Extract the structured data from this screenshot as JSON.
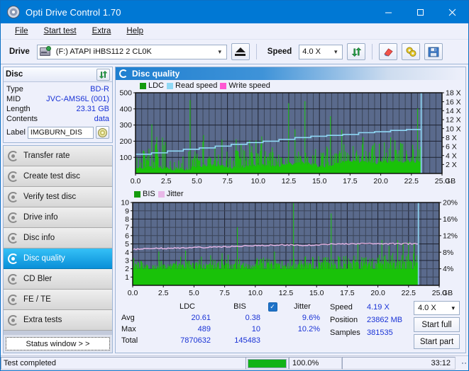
{
  "window": {
    "title": "Opti Drive Control 1.70",
    "icon": "disc-icon",
    "minimize": "minimize-icon",
    "maximize": "maximize-icon",
    "close": "close-icon"
  },
  "menu": {
    "items": [
      {
        "label": "File",
        "accel": "F"
      },
      {
        "label": "Start test",
        "accel": "S"
      },
      {
        "label": "Extra",
        "accel": "x"
      },
      {
        "label": "Help",
        "accel": "H"
      }
    ]
  },
  "toolbar": {
    "drive_label": "Drive",
    "drive_value": "(F:)  ATAPI iHBS112  2 CL0K",
    "eject_icon": "eject-icon",
    "speed_label": "Speed",
    "speed_value": "4.0 X",
    "refresh_icon": "refresh-icon",
    "eraser_icon": "eraser-icon",
    "settings_icon": "settings-icon",
    "save_icon": "save-icon"
  },
  "disc_panel": {
    "title": "Disc",
    "refresh_icon": "refresh-icon",
    "rows": [
      {
        "key": "Type",
        "value": "BD-R"
      },
      {
        "key": "MID",
        "value": "JVC-AMS6L (001)"
      },
      {
        "key": "Length",
        "value": "23.31 GB"
      },
      {
        "key": "Contents",
        "value": "data"
      }
    ],
    "label_key": "Label",
    "label_value": "IMGBURN_DIS",
    "label_icon": "cd-icon"
  },
  "nav": {
    "items": [
      {
        "label": "Transfer rate",
        "icon": "disc-transfer-icon",
        "selected": false
      },
      {
        "label": "Create test disc",
        "icon": "disc-create-icon",
        "selected": false
      },
      {
        "label": "Verify test disc",
        "icon": "disc-verify-icon",
        "selected": false
      },
      {
        "label": "Drive info",
        "icon": "disc-drive-icon",
        "selected": false
      },
      {
        "label": "Disc info",
        "icon": "disc-info-icon",
        "selected": false
      },
      {
        "label": "Disc quality",
        "icon": "disc-quality-icon",
        "selected": true
      },
      {
        "label": "CD Bler",
        "icon": "disc-bler-icon",
        "selected": false
      },
      {
        "label": "FE / TE",
        "icon": "disc-fete-icon",
        "selected": false
      },
      {
        "label": "Extra tests",
        "icon": "disc-extra-icon",
        "selected": false
      }
    ],
    "status_button": "Status window > >"
  },
  "panel_header": {
    "title": "Disc quality",
    "icon": "disc-quality-icon"
  },
  "stats": {
    "col_ldc": "LDC",
    "col_bis": "BIS",
    "jitter_label": "Jitter",
    "jitter_checked": true,
    "rows": [
      {
        "key": "Avg",
        "ldc": "20.61",
        "bis": "0.38",
        "jitter": "9.6%"
      },
      {
        "key": "Max",
        "ldc": "489",
        "bis": "10",
        "jitter": "10.2%"
      },
      {
        "key": "Total",
        "ldc": "7870632",
        "bis": "145483",
        "jitter": ""
      }
    ],
    "speed_key": "Speed",
    "speed_value": "4.19 X",
    "position_key": "Position",
    "position_value": "23862 MB",
    "samples_key": "Samples",
    "samples_value": "381535",
    "speed_select": "4.0 X",
    "start_full": "Start full",
    "start_part": "Start part"
  },
  "statusbar": {
    "message": "Test completed",
    "percent_label": "100.0%",
    "progress": 100,
    "time": "33:12",
    "progress_color": "#12b317"
  },
  "colors": {
    "accent": "#0078d4",
    "plot_bg": "#5a6a8c",
    "ldc_green": "#19c209",
    "bis_green": "#19c209",
    "read_speed": "#8fd8f5",
    "write_speed": "#ff57d2",
    "jitter_pink": "#e8b8e8",
    "value_blue": "#1a33d6"
  },
  "chart_data": [
    {
      "type": "area",
      "id": "ldc-chart",
      "title": "",
      "xlabel": "GB",
      "ylabel": "LDC",
      "xlim": [
        0,
        25.0
      ],
      "ylim": [
        0,
        500
      ],
      "y2lim": [
        0,
        18
      ],
      "y2label": "X",
      "xticks": [
        "0.0",
        "2.5",
        "5.0",
        "7.5",
        "10.0",
        "12.5",
        "15.0",
        "17.5",
        "20.0",
        "22.5",
        "25.0"
      ],
      "yticks": [
        100,
        200,
        300,
        400,
        500
      ],
      "y2ticks": [
        "2 X",
        "4 X",
        "6 X",
        "8 X",
        "10 X",
        "12 X",
        "14 X",
        "16 X",
        "18 X"
      ],
      "x_unit": "GB",
      "grid": true,
      "legend": [
        {
          "name": "LDC",
          "color": "#19c209"
        },
        {
          "name": "Read speed",
          "color": "#8fd8f5"
        },
        {
          "name": "Write speed",
          "color": "#ff57d2"
        }
      ],
      "data_end_x": 23.3,
      "series": [
        {
          "name": "LDC",
          "color": "#19c209",
          "kind": "spike-area",
          "baseline": [
            28,
            30,
            30,
            32,
            30,
            31,
            33,
            30,
            32,
            31,
            30,
            33,
            31,
            30,
            32,
            34,
            31,
            30,
            33,
            31,
            30,
            32,
            31,
            33,
            30,
            32,
            31,
            30,
            33,
            31,
            32,
            30,
            33,
            31,
            30,
            32,
            34,
            31,
            33,
            30,
            32,
            31,
            33,
            30,
            32,
            31,
            34,
            30,
            33,
            31,
            32,
            30,
            33,
            31,
            35,
            32,
            30,
            33,
            31,
            34,
            32,
            30,
            33,
            36,
            31,
            34,
            32,
            30,
            33,
            35,
            31,
            34,
            32,
            36,
            33,
            31,
            35,
            32,
            34,
            37,
            31,
            33,
            36,
            32,
            35,
            31,
            34,
            38,
            32,
            36,
            33,
            31,
            37,
            34,
            32,
            38,
            35,
            33,
            40,
            36,
            34,
            32,
            39,
            36,
            42,
            34,
            37,
            33,
            40,
            36,
            38,
            34,
            41,
            37,
            35,
            43,
            38,
            36,
            40,
            34,
            42,
            38,
            45,
            36,
            40,
            37,
            43,
            39,
            41,
            35,
            44,
            38,
            42,
            46,
            39,
            37,
            43,
            40,
            48,
            41,
            38,
            45,
            42,
            39,
            47,
            43,
            40,
            50,
            44,
            41,
            46,
            43,
            52,
            45,
            42,
            48,
            44,
            51,
            46,
            43,
            49,
            45,
            55,
            47,
            44,
            50,
            46,
            53,
            48,
            45,
            52,
            49,
            46,
            56,
            50,
            47,
            54,
            51,
            48,
            58,
            52,
            49,
            55,
            53,
            50,
            60,
            54,
            51,
            57,
            55,
            52,
            62,
            56,
            53,
            59,
            57,
            54,
            64,
            58,
            55,
            61,
            59,
            56,
            66,
            60,
            57,
            63,
            61,
            58,
            68,
            62,
            59,
            65,
            63,
            60,
            70,
            64,
            61,
            67,
            65,
            62,
            72,
            66,
            63,
            69,
            67,
            64,
            74,
            68,
            65,
            71,
            69,
            66,
            76,
            70,
            67,
            73,
            71,
            68,
            78,
            72,
            69,
            75,
            73,
            70,
            80,
            74,
            71,
            77,
            75,
            72,
            82,
            76,
            73,
            79,
            77,
            74,
            84,
            78,
            75,
            81,
            79,
            76,
            86,
            80,
            77,
            83,
            81,
            78,
            88,
            82,
            79,
            85,
            83,
            80,
            90,
            84,
            81,
            87,
            85,
            82,
            92,
            86,
            83,
            89,
            87,
            84,
            94,
            88,
            85,
            91,
            89,
            86,
            96,
            90,
            87,
            93,
            91,
            88,
            98,
            92,
            89,
            95
          ]
        }
      ],
      "read_speed_steps": [
        {
          "x": 0.0,
          "v": 4.3
        },
        {
          "x": 1.3,
          "v": 4.6
        },
        {
          "x": 2.6,
          "v": 5.0
        },
        {
          "x": 3.9,
          "v": 5.4
        },
        {
          "x": 5.2,
          "v": 5.7
        },
        {
          "x": 6.5,
          "v": 6.1
        },
        {
          "x": 7.8,
          "v": 6.5
        },
        {
          "x": 9.1,
          "v": 6.9
        },
        {
          "x": 10.4,
          "v": 7.2
        },
        {
          "x": 11.7,
          "v": 7.6
        },
        {
          "x": 13.0,
          "v": 8.0
        },
        {
          "x": 14.3,
          "v": 8.3
        },
        {
          "x": 15.6,
          "v": 8.5
        },
        {
          "x": 16.9,
          "v": 8.7
        },
        {
          "x": 18.2,
          "v": 9.1
        },
        {
          "x": 19.5,
          "v": 9.3
        },
        {
          "x": 20.8,
          "v": 9.6
        },
        {
          "x": 22.1,
          "v": 9.8
        },
        {
          "x": 23.3,
          "v": 9.9
        }
      ],
      "ldc_avg": 20.61,
      "ldc_max": 489,
      "ldc_total": 7870632
    },
    {
      "type": "area",
      "id": "bis-chart",
      "title": "",
      "xlabel": "GB",
      "ylabel": "BIS",
      "xlim": [
        0,
        25.0
      ],
      "ylim": [
        0,
        10
      ],
      "y2lim": [
        0,
        20
      ],
      "y2label": "%",
      "xticks": [
        "0.0",
        "2.5",
        "5.0",
        "7.5",
        "10.0",
        "12.5",
        "15.0",
        "17.5",
        "20.0",
        "22.5",
        "25.0"
      ],
      "yticks": [
        1,
        2,
        3,
        4,
        5,
        6,
        7,
        8,
        9,
        10
      ],
      "y2ticks": [
        "4%",
        "8%",
        "12%",
        "16%",
        "20%"
      ],
      "x_unit": "GB",
      "grid": true,
      "legend": [
        {
          "name": "BIS",
          "color": "#19c209"
        },
        {
          "name": "Jitter",
          "color": "#e8b8e8"
        }
      ],
      "data_end_x": 23.3,
      "series": [
        {
          "name": "BIS",
          "color": "#19c209",
          "kind": "spike-area",
          "baseline_level": 2.0,
          "max": 10
        }
      ],
      "jitter_steps": [
        {
          "x": 0.0,
          "v": 4.35
        },
        {
          "x": 2.0,
          "v": 4.45
        },
        {
          "x": 4.0,
          "v": 4.5
        },
        {
          "x": 6.0,
          "v": 4.6
        },
        {
          "x": 8.0,
          "v": 4.7
        },
        {
          "x": 10.0,
          "v": 4.8
        },
        {
          "x": 12.0,
          "v": 4.9
        },
        {
          "x": 14.0,
          "v": 4.85
        },
        {
          "x": 16.0,
          "v": 4.95
        },
        {
          "x": 18.0,
          "v": 5.0
        },
        {
          "x": 20.0,
          "v": 5.05
        },
        {
          "x": 22.0,
          "v": 5.0
        },
        {
          "x": 23.3,
          "v": 5.05
        }
      ],
      "bis_avg": 0.38,
      "bis_max": 10,
      "bis_total": 145483,
      "jitter_avg": "9.6%",
      "jitter_max": "10.2%"
    }
  ]
}
